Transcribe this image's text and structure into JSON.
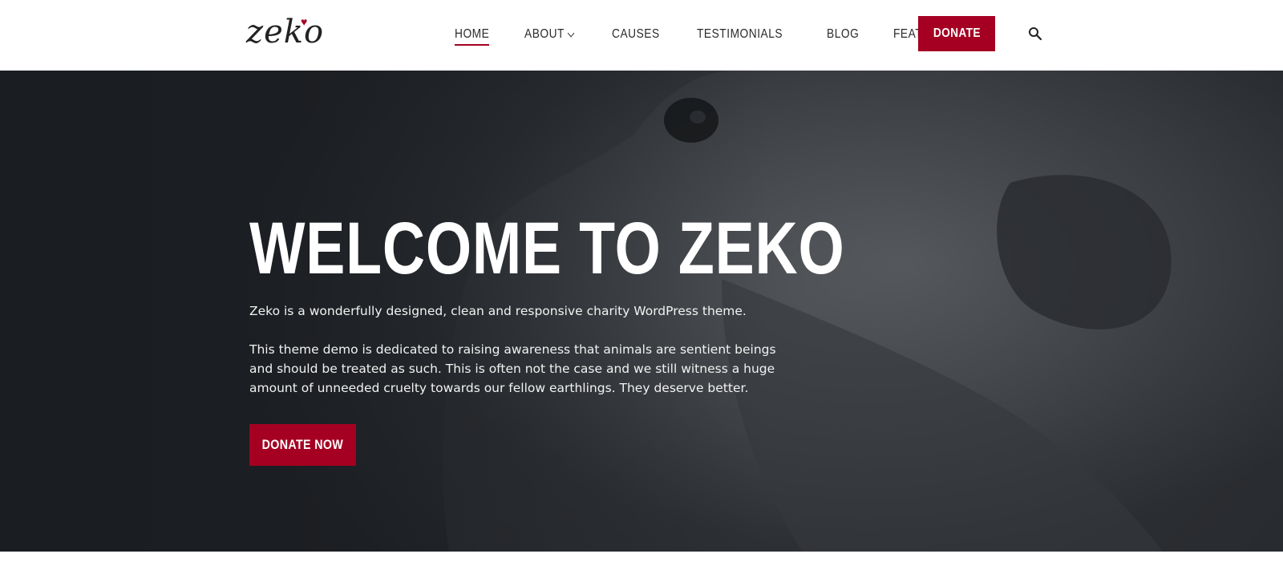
{
  "header": {
    "logo_text": "zeko",
    "nav": [
      {
        "label": "HOME",
        "has_dropdown": false,
        "active": true
      },
      {
        "label": "ABOUT",
        "has_dropdown": true,
        "active": false
      },
      {
        "label": "CAUSES",
        "has_dropdown": false,
        "active": false
      },
      {
        "label": "TESTIMONIALS",
        "has_dropdown": false,
        "active": false
      },
      {
        "label": "BLOG",
        "has_dropdown": false,
        "active": false
      },
      {
        "label": "FEATURES",
        "has_dropdown": true,
        "active": false
      }
    ],
    "donate_label": "DONATE",
    "search_icon": "search-icon"
  },
  "hero": {
    "title": "WELCOME TO ZEKO",
    "paragraph1": "Zeko is a wonderfully designed, clean and responsive charity WordPress theme.",
    "paragraph2": "This theme demo is dedicated to raising awareness that animals are sentient beings and should be treated as such. This is often not the case and we still witness a huge amount of unneeded cruelty towards our fellow earthlings. They deserve better.",
    "button_label": "DONATE NOW"
  },
  "colors": {
    "accent": "#a50022",
    "hero_dark": "#1e2125",
    "text_dark": "#2b2b2b"
  }
}
